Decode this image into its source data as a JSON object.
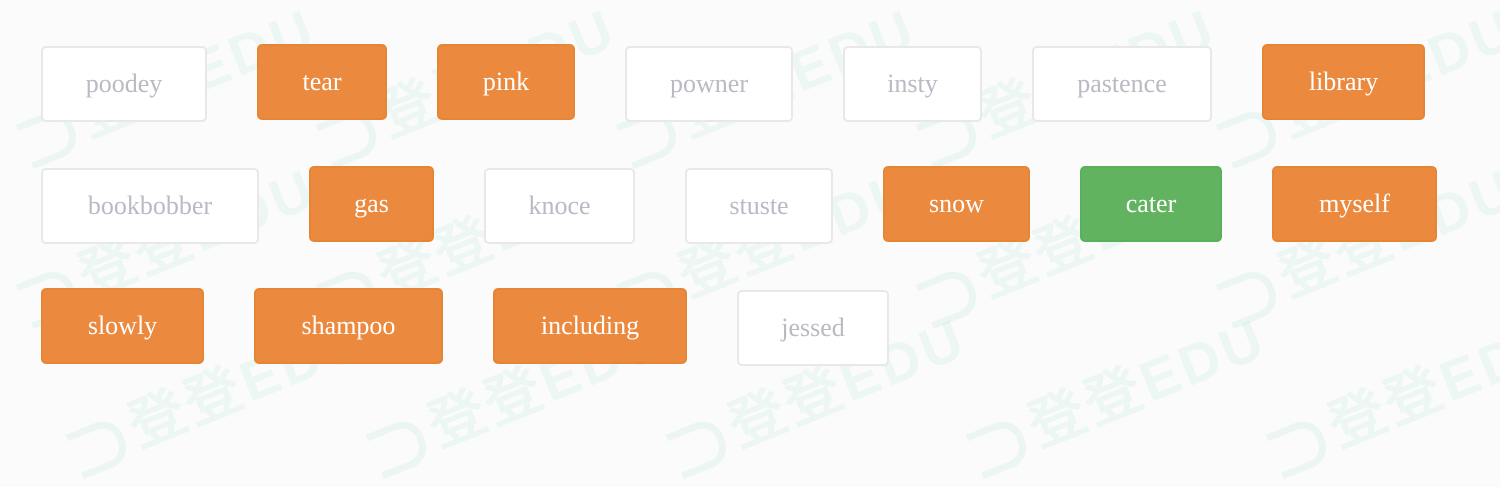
{
  "watermark": {
    "text": "登登EDU"
  },
  "colors": {
    "selected": "#eb893e",
    "correct": "#62b35f",
    "unselected_border": "#e8e8ec",
    "unselected_text": "#b9bac3"
  },
  "rows": [
    [
      {
        "text": "poodey",
        "state": "unselected"
      },
      {
        "text": "tear",
        "state": "selected"
      },
      {
        "text": "pink",
        "state": "selected"
      },
      {
        "text": "powner",
        "state": "unselected"
      },
      {
        "text": "insty",
        "state": "unselected"
      },
      {
        "text": "pastence",
        "state": "unselected"
      },
      {
        "text": "library",
        "state": "selected"
      }
    ],
    [
      {
        "text": "bookbobber",
        "state": "unselected"
      },
      {
        "text": "gas",
        "state": "selected"
      },
      {
        "text": "knoce",
        "state": "unselected"
      },
      {
        "text": "stuste",
        "state": "unselected"
      },
      {
        "text": "snow",
        "state": "selected"
      },
      {
        "text": "cater",
        "state": "correct"
      },
      {
        "text": "myself",
        "state": "selected"
      }
    ],
    [
      {
        "text": "slowly",
        "state": "selected"
      },
      {
        "text": "shampoo",
        "state": "selected"
      },
      {
        "text": "including",
        "state": "selected"
      },
      {
        "text": "jessed",
        "state": "unselected"
      }
    ]
  ]
}
